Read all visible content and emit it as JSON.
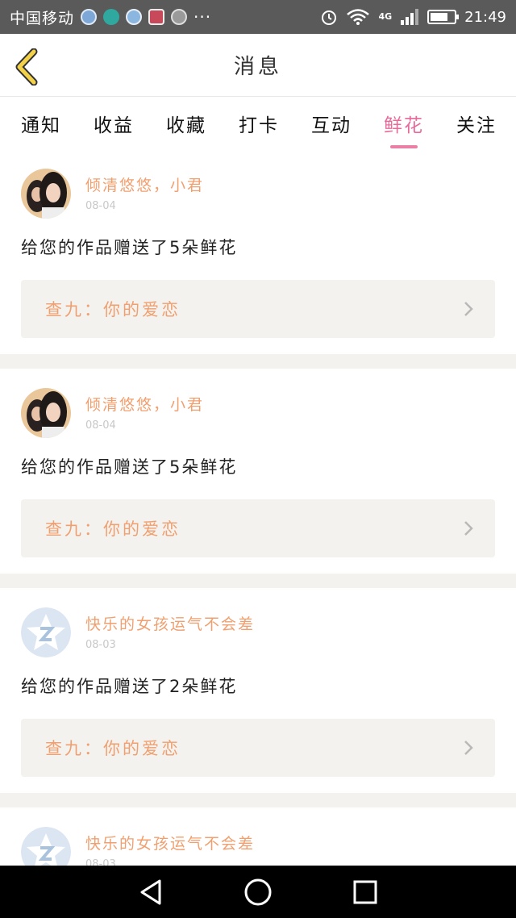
{
  "status_bar": {
    "carrier": "中国移动",
    "more": "···",
    "network": "4G",
    "time": "21:49",
    "battery_level": 0.75
  },
  "header": {
    "title": "消息"
  },
  "tabs": [
    {
      "label": "通知",
      "active": false
    },
    {
      "label": "收益",
      "active": false
    },
    {
      "label": "收藏",
      "active": false
    },
    {
      "label": "打卡",
      "active": false
    },
    {
      "label": "互动",
      "active": false
    },
    {
      "label": "鲜花",
      "active": true
    },
    {
      "label": "关注",
      "active": false
    }
  ],
  "messages": [
    {
      "username": "倾清悠悠，小君",
      "date": "08-04",
      "text": "给您的作品赠送了5朵鲜花",
      "work": "查九：你的爱恋",
      "avatar": "photo-avatar"
    },
    {
      "username": "倾清悠悠，小君",
      "date": "08-04",
      "text": "给您的作品赠送了5朵鲜花",
      "work": "查九：你的爱恋",
      "avatar": "photo-avatar"
    },
    {
      "username": "快乐的女孩运气不会差",
      "date": "08-03",
      "text": "给您的作品赠送了2朵鲜花",
      "work": "查九：你的爱恋",
      "avatar": "default-avatar"
    },
    {
      "username": "快乐的女孩运气不会差",
      "date": "08-03",
      "text": "",
      "work": "",
      "avatar": "default-avatar"
    }
  ],
  "colors": {
    "accent_pink": "#e86a9a",
    "accent_orange": "#f0a070",
    "card_gray": "#f3f2ee"
  }
}
